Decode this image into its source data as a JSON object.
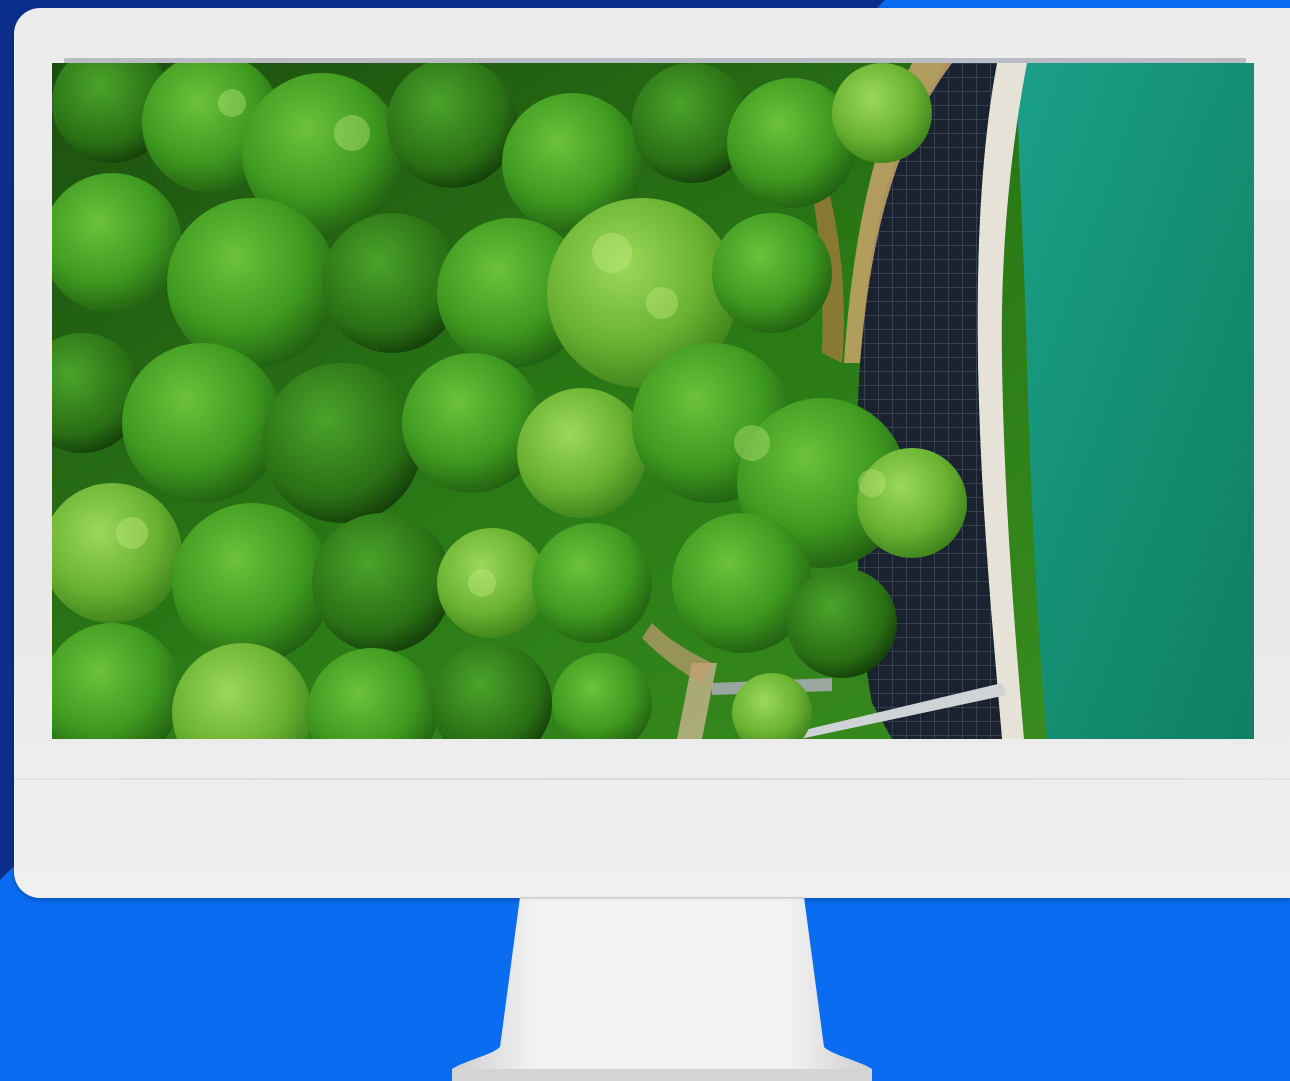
{
  "scene": {
    "description_icon": "desktop-monitor-icon",
    "colors": {
      "background_primary": "#0a6cf0",
      "background_dark": "#0b2e8a",
      "monitor_frame": "#ececec",
      "forest": "#2f8a1a",
      "water": "#17967a",
      "dam_wall": "#1c2433"
    }
  }
}
